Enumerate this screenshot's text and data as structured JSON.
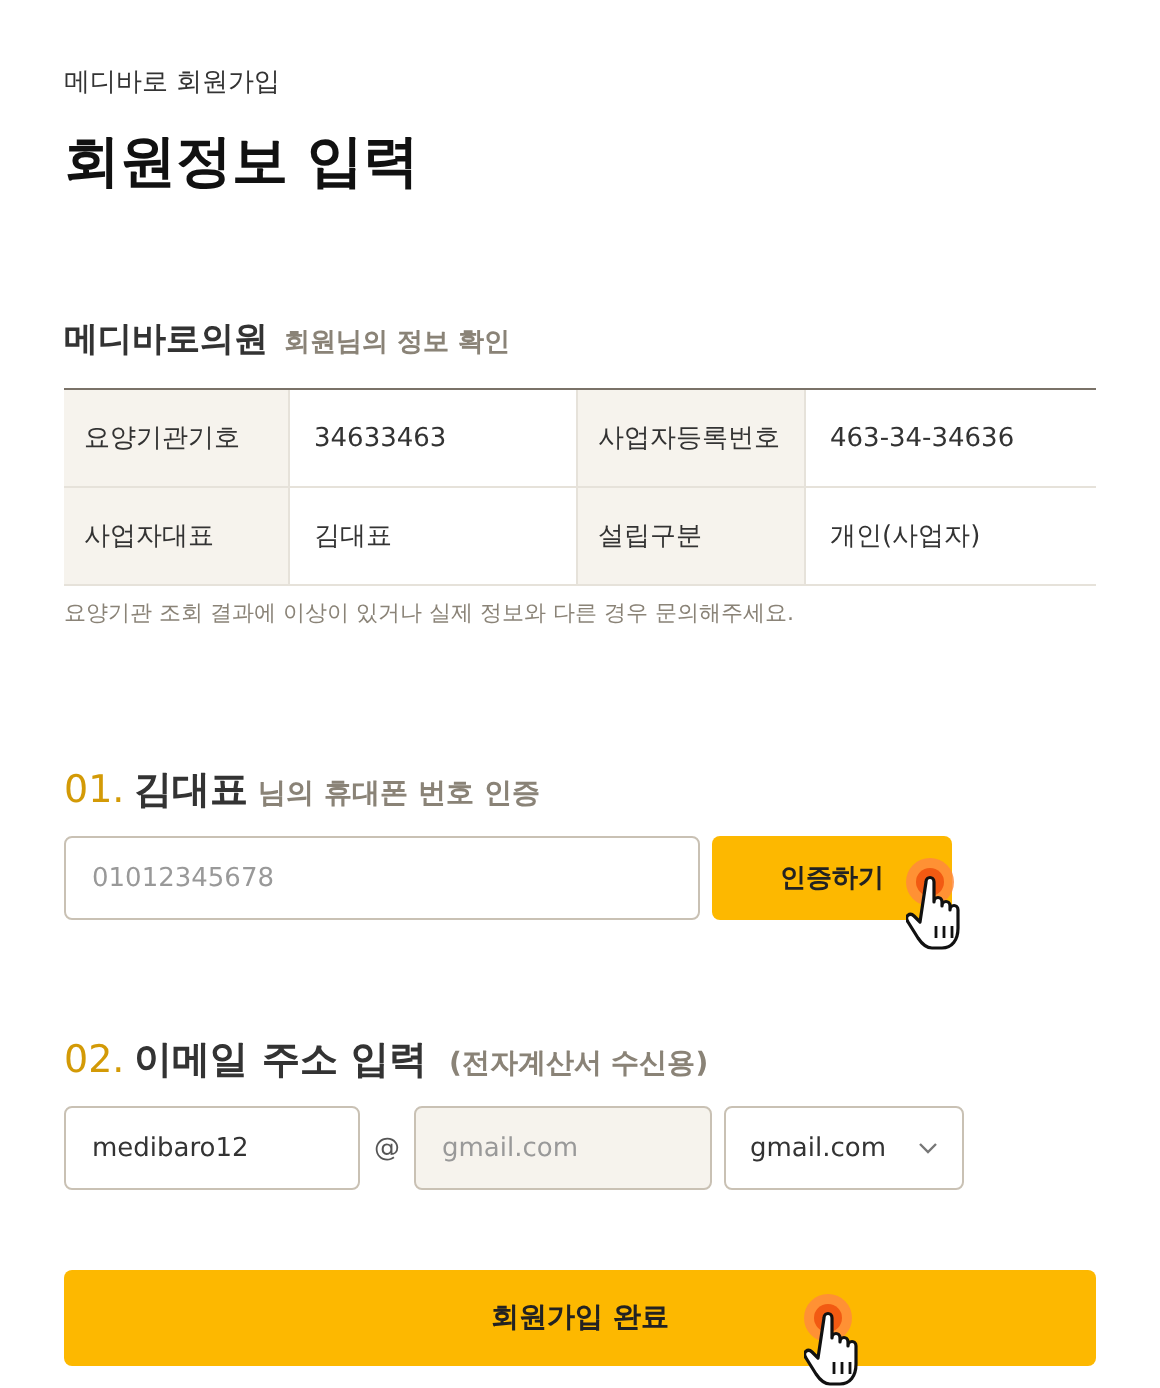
{
  "header": {
    "breadcrumb": "메디바로 회원가입",
    "title": "회원정보 입력"
  },
  "clinic": {
    "name": "메디바로의원",
    "subtitle": "회원님의 정보 확인",
    "rows": [
      [
        {
          "kind": "label",
          "text": "요양기관기호"
        },
        {
          "kind": "value",
          "text": "34633463"
        },
        {
          "kind": "label",
          "text": "사업자등록번호"
        },
        {
          "kind": "value",
          "text": "463-34-34636"
        }
      ],
      [
        {
          "kind": "label",
          "text": "사업자대표"
        },
        {
          "kind": "value",
          "text": "김대표"
        },
        {
          "kind": "label",
          "text": "설립구분"
        },
        {
          "kind": "value",
          "text": "개인(사업자)"
        }
      ]
    ],
    "note": "요양기관 조회 결과에 이상이 있거나 실제 정보와 다른 경우 문의해주세요."
  },
  "phone": {
    "number": "01.",
    "name": "김대표",
    "suffix": "님의 휴대폰 번호 인증",
    "placeholder": "01012345678",
    "button": "인증하기"
  },
  "email": {
    "number": "02.",
    "title": "이메일 주소 입력",
    "note": "(전자계산서 수신용)",
    "local": "medibaro12",
    "at": "@",
    "domain": {
      "placeholder": "gmail.com",
      "disabled": true
    },
    "select": "gmail.com"
  },
  "submit": "회원가입 완료"
}
